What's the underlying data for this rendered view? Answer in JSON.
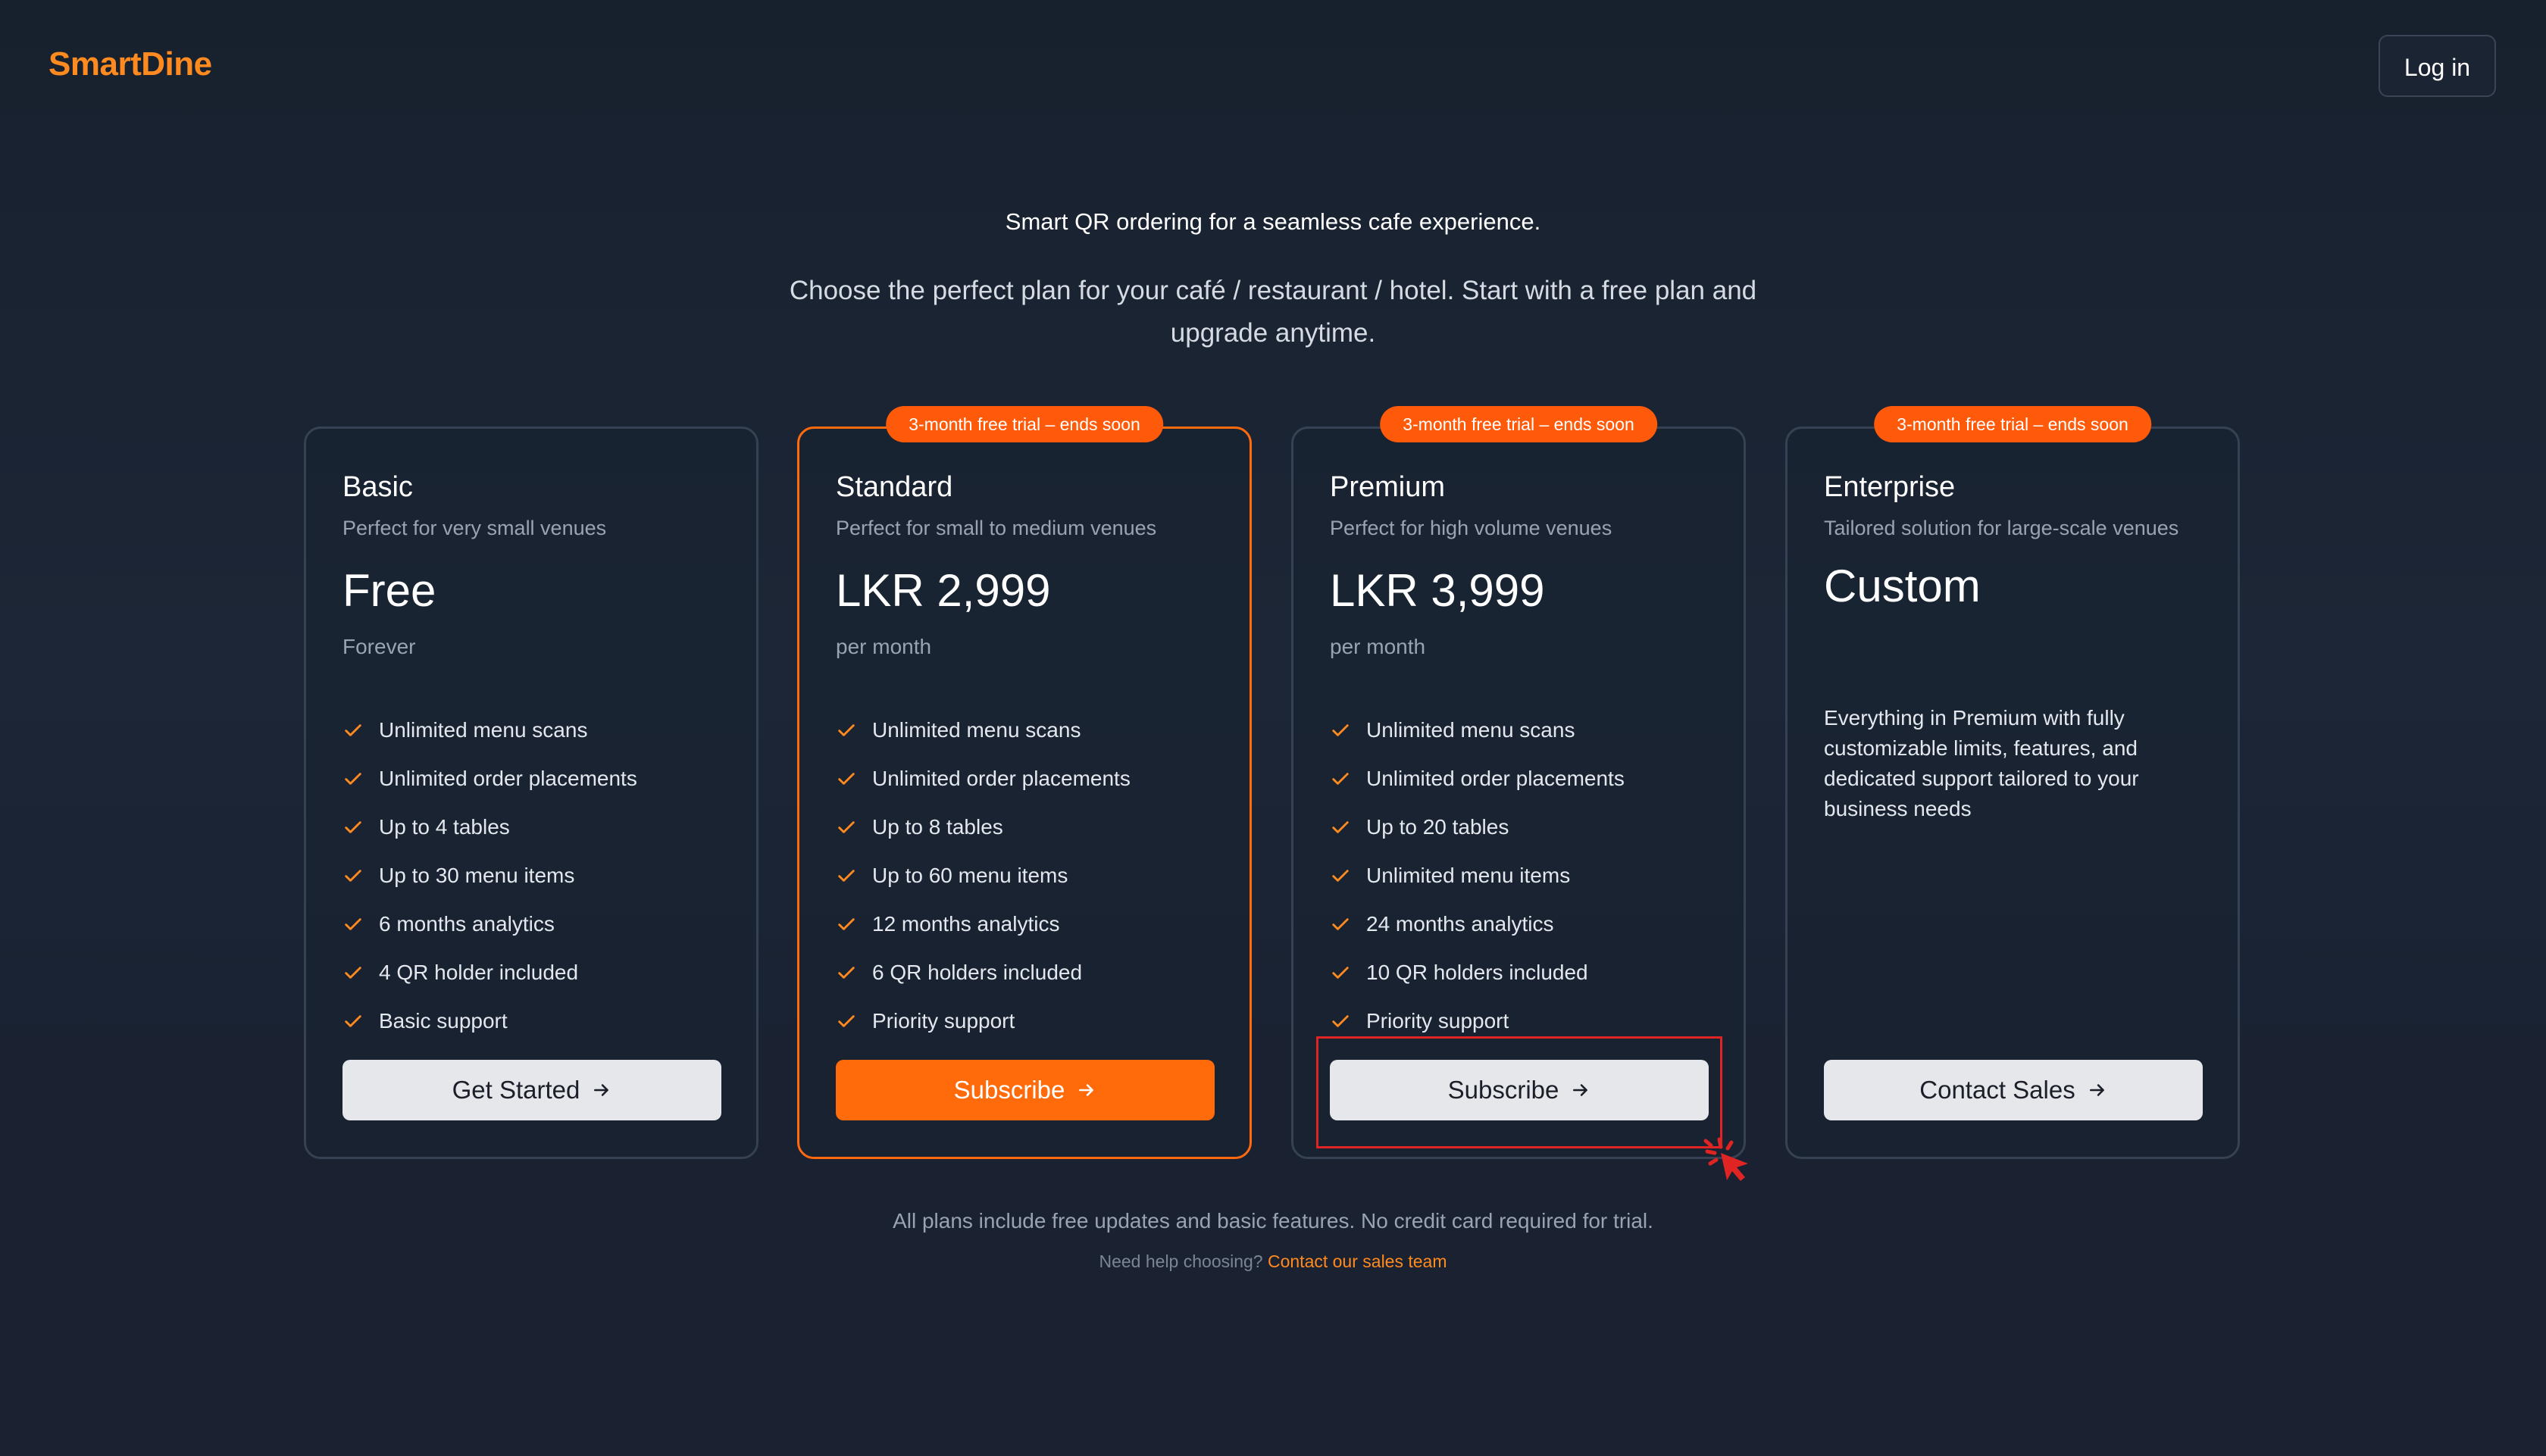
{
  "app": {
    "logo": "SmartDine",
    "login_label": "Log in"
  },
  "hero": {
    "tagline": "Smart QR ordering for a seamless cafe experience.",
    "subtitle": "Choose the perfect plan for your café / restaurant / hotel. Start with a free plan and upgrade anytime."
  },
  "colors": {
    "accent": "#ff6a0a",
    "logo": "#ff8a1f",
    "badge": "#ff5a0a",
    "check": "#ff8a1f",
    "highlight_annotation": "#e02424"
  },
  "plans": [
    {
      "name": "Basic",
      "description": "Perfect for very small venues",
      "price": "Free",
      "period": "Forever",
      "features": [
        "Unlimited menu scans",
        "Unlimited order placements",
        "Up to 4 tables",
        "Up to 30 menu items",
        "6 months analytics",
        "4 QR holder included",
        "Basic support"
      ],
      "cta": "Get Started"
    },
    {
      "name": "Standard",
      "badge": "3-month free trial – ends soon",
      "description": "Perfect for small to medium venues",
      "price": "LKR 2,999",
      "period": "per month",
      "features": [
        "Unlimited menu scans",
        "Unlimited order placements",
        "Up to 8 tables",
        "Up to 60 menu items",
        "12 months analytics",
        "6 QR holders included",
        "Priority support"
      ],
      "cta": "Subscribe"
    },
    {
      "name": "Premium",
      "badge": "3-month free trial – ends soon",
      "description": "Perfect for high volume venues",
      "price": "LKR 3,999",
      "period": "per month",
      "features": [
        "Unlimited menu scans",
        "Unlimited order placements",
        "Up to 20 tables",
        "Unlimited menu items",
        "24 months analytics",
        "10 QR holders included",
        "Priority support"
      ],
      "cta": "Subscribe"
    },
    {
      "name": "Enterprise",
      "badge": "3-month free trial – ends soon",
      "description": "Tailored solution for large-scale venues",
      "price": "Custom",
      "details": "Everything in Premium with fully customizable limits, features, and dedicated support tailored to your business needs",
      "cta": "Contact Sales"
    }
  ],
  "footer": {
    "note": "All plans include free updates and basic features. No credit card required for trial.",
    "help_text": "Need help choosing?",
    "help_link": "Contact our sales team"
  }
}
